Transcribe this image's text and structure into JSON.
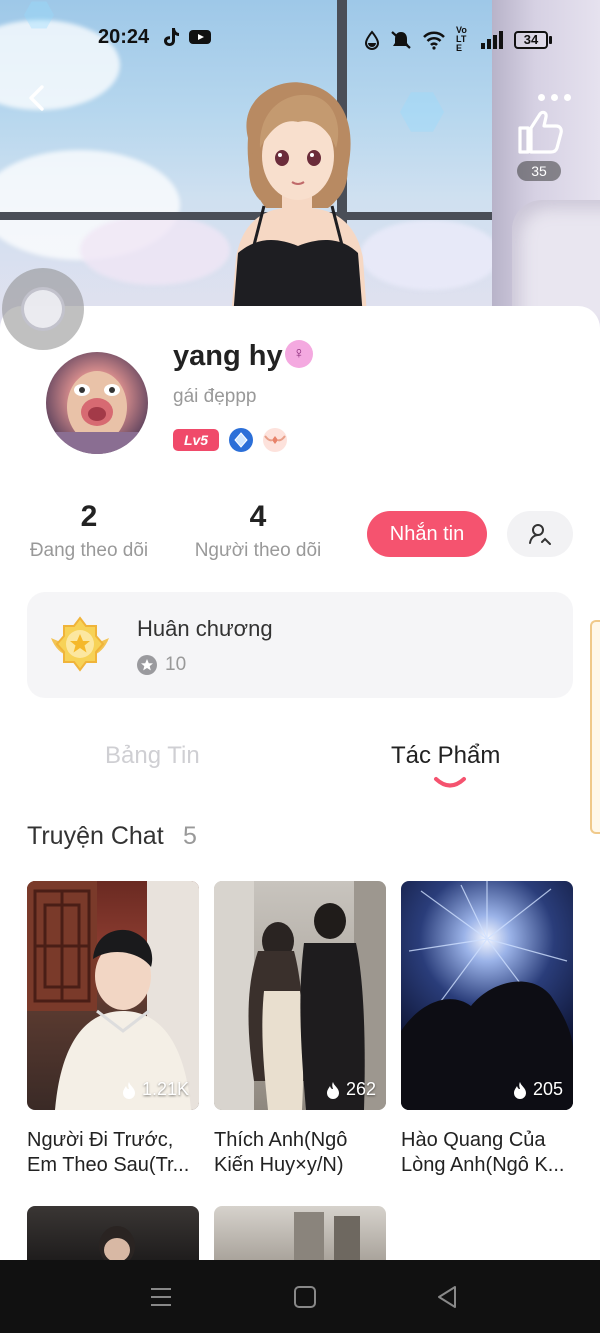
{
  "status_bar": {
    "time": "20:24",
    "battery_level": "34",
    "network_label": "Vo LTE"
  },
  "header": {
    "like_count": "35"
  },
  "profile": {
    "username": "yang hy",
    "gender_symbol": "♀",
    "bio": "gái đẹppp",
    "level_badge": "Lv5"
  },
  "stats": {
    "following_count": "2",
    "following_label": "Đang theo dõi",
    "followers_count": "4",
    "followers_label": "Người theo dõi"
  },
  "actions": {
    "message_label": "Nhắn tin"
  },
  "medal": {
    "title": "Huân chương",
    "count": "10"
  },
  "tabs": [
    {
      "label": "Bảng Tin",
      "active": false
    },
    {
      "label": "Tác Phẩm",
      "active": true
    }
  ],
  "section": {
    "title": "Truyện Chat",
    "count": "5"
  },
  "stories": [
    {
      "title": "Người Đi Trước, Em Theo Sau(Tr...",
      "views": "1.21K"
    },
    {
      "title": "Thích Anh(Ngô Kiến Huy×y/N)",
      "views": "262"
    },
    {
      "title": "Hào Quang Của Lòng Anh(Ngô K...",
      "views": "205"
    }
  ],
  "icons": {
    "back": "chevron-left-icon",
    "more": "more-dots-icon",
    "like": "thumbs-up-icon",
    "follow": "add-user-icon",
    "fire": "fire-icon",
    "star": "star-icon"
  },
  "colors": {
    "accent": "#f5536f",
    "level_badge": "#f04a6a",
    "gender_badge": "#f4a9e0"
  }
}
